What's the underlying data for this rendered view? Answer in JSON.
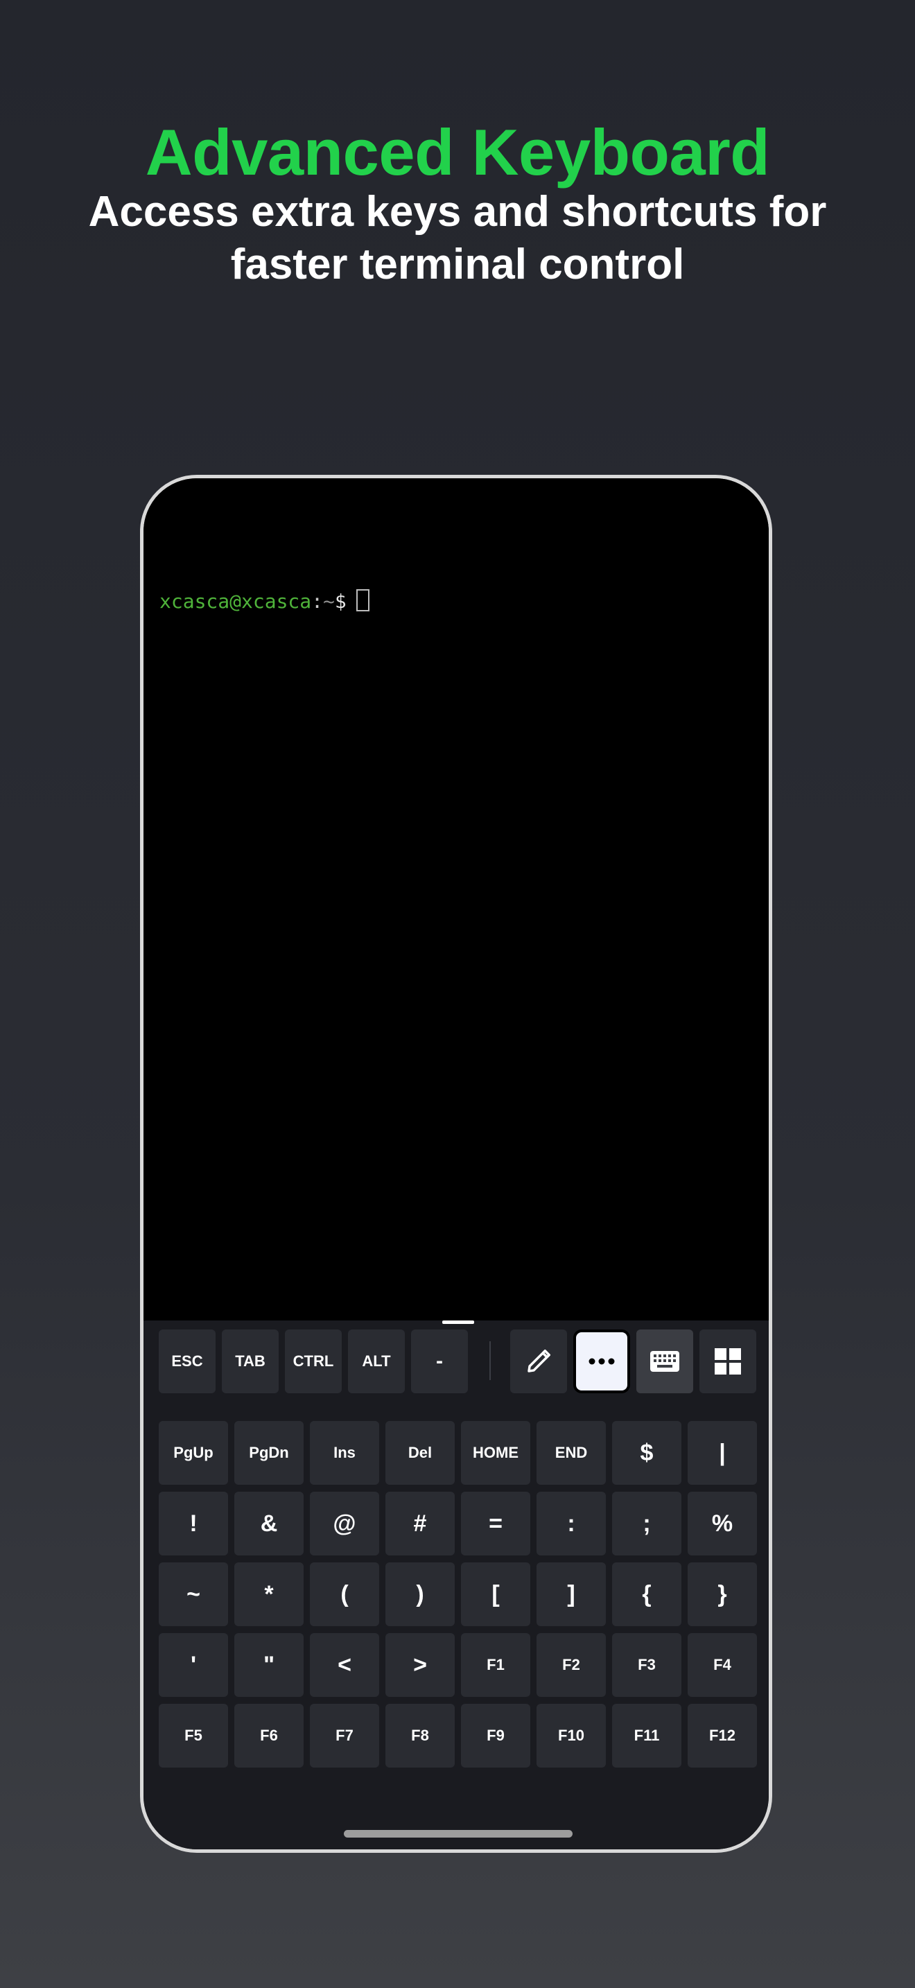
{
  "header": {
    "title": "Advanced Keyboard",
    "subtitle": "Access extra keys and shortcuts for faster terminal control"
  },
  "terminal": {
    "prompt_user": "xcasca@xcasca",
    "prompt_sep": ":",
    "prompt_path": "~",
    "prompt_dollar": "$"
  },
  "toolbar": {
    "keys": [
      "ESC",
      "TAB",
      "CTRL",
      "ALT",
      "-"
    ],
    "icons": [
      "pencil-icon",
      "more-icon",
      "keyboard-icon",
      "grid-icon"
    ],
    "active_icon": "more-icon"
  },
  "keyboard": {
    "rows": [
      [
        "PgUp",
        "PgDn",
        "Ins",
        "Del",
        "HOME",
        "END",
        "$",
        "|"
      ],
      [
        "!",
        "&",
        "@",
        "#",
        "=",
        ":",
        ";",
        "%"
      ],
      [
        "~",
        "*",
        "(",
        ")",
        "[",
        "]",
        "{",
        "}"
      ],
      [
        "'",
        "\"",
        "<",
        ">",
        "F1",
        "F2",
        "F3",
        "F4"
      ],
      [
        "F5",
        "F6",
        "F7",
        "F8",
        "F9",
        "F10",
        "F11",
        "F12"
      ]
    ]
  },
  "colors": {
    "accent": "#22d14b",
    "prompt_green": "#4fb33a",
    "key_bg": "#2a2c32",
    "keyboard_bg": "#1a1b20",
    "active_key_bg": "#f1f3fc"
  }
}
